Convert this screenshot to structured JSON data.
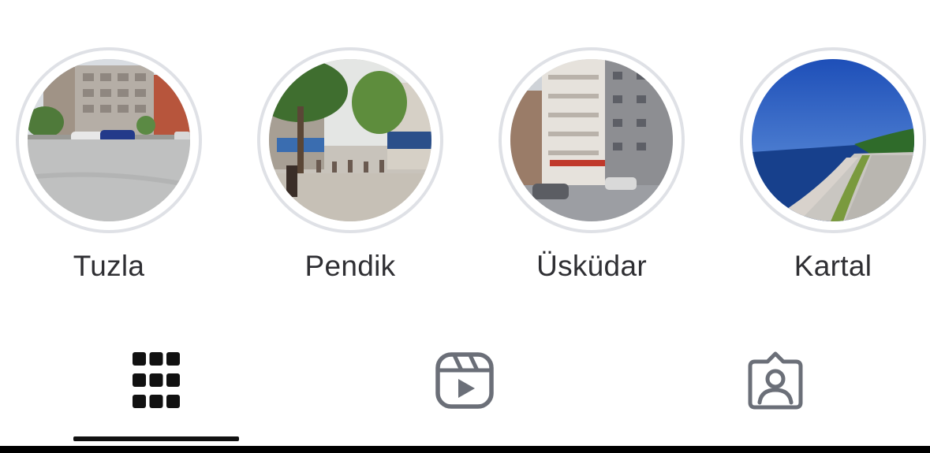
{
  "highlights": [
    {
      "label": "Tuzla",
      "icon": "photo-street-parking"
    },
    {
      "label": "Pendik",
      "icon": "photo-street-trees"
    },
    {
      "label": "Üsküdar",
      "icon": "photo-apartment-building"
    },
    {
      "label": "Kartal",
      "icon": "photo-seaside-promenade"
    }
  ],
  "tabs": [
    {
      "icon": "grid-icon",
      "active": true
    },
    {
      "icon": "reels-icon",
      "active": false
    },
    {
      "icon": "tagged-icon",
      "active": false
    }
  ],
  "colors": {
    "ring": "#dfe1e6",
    "label": "#2f2f33",
    "tab_active": "#111111",
    "tab_inactive": "#6b6f78"
  }
}
